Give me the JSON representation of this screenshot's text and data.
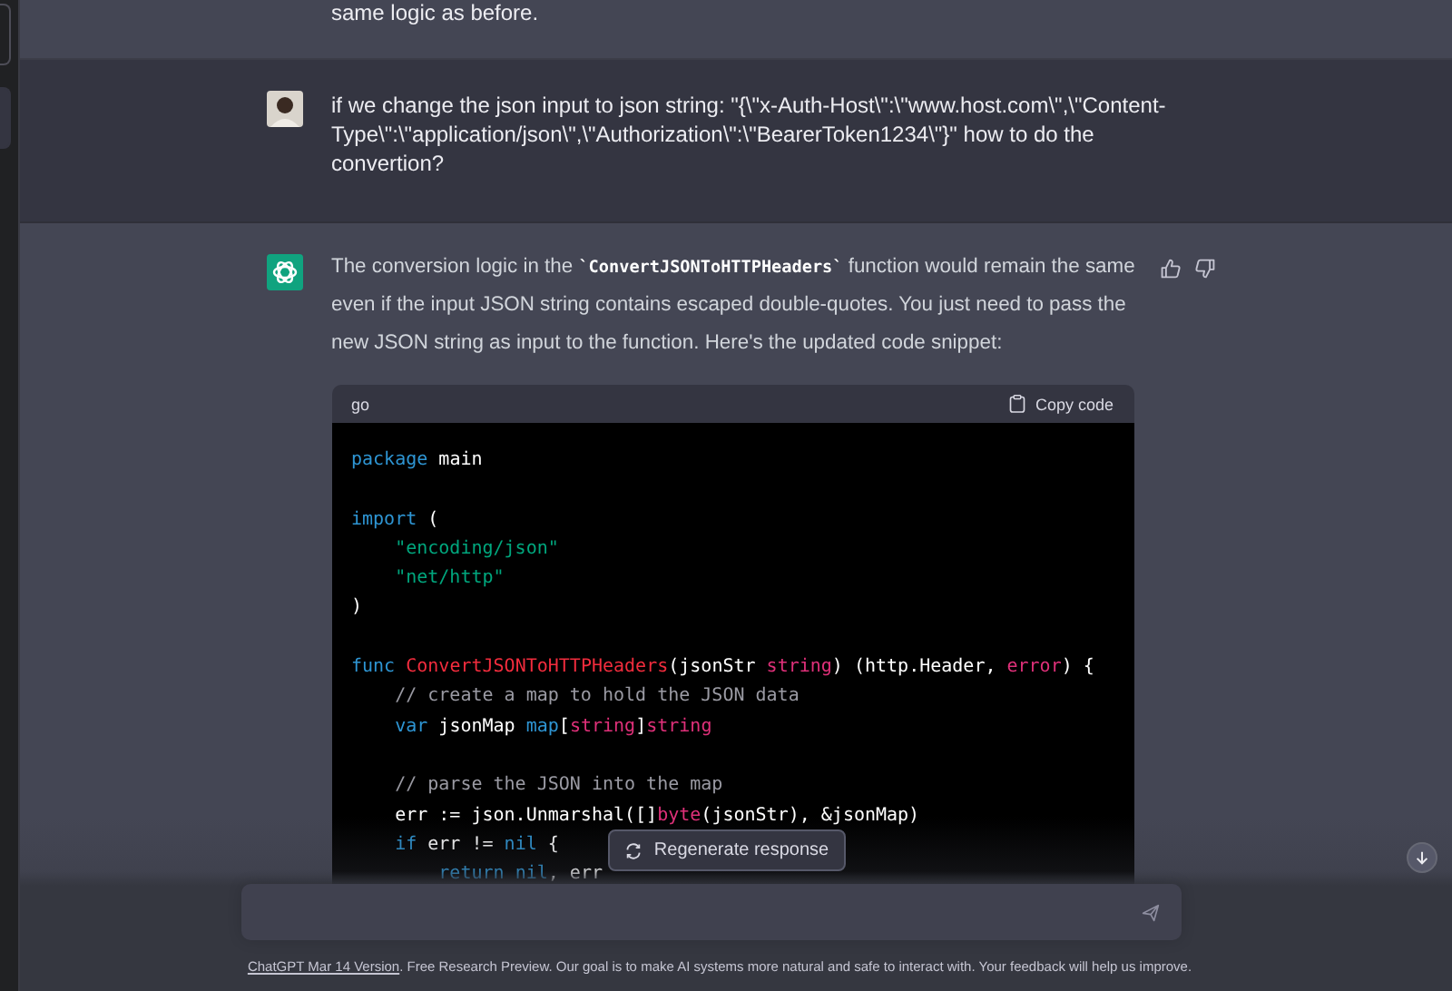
{
  "sidebar": {
    "items": [
      {
        "selected": false
      },
      {
        "selected": true
      }
    ]
  },
  "previous_message": {
    "text": "same logic as before."
  },
  "user_message": {
    "text": "if we change the json input to json string: \"{\\\"x-Auth-Host\\\":\\\"www.host.com\\\",\\\"Content-Type\\\":\\\"application/json\\\",\\\"Authorization\\\":\\\"BearerToken1234\\\"}\" how to do the convertion?"
  },
  "assistant_message": {
    "parts": [
      {
        "kind": "text",
        "text": "The conversion logic in the "
      },
      {
        "kind": "code",
        "text": "`ConvertJSONToHTTPHeaders`"
      },
      {
        "kind": "text",
        "text": " function would remain the same even if the input JSON string contains escaped double-quotes. You just need to pass the new JSON string as input to the function. Here's the updated code snippet:"
      }
    ],
    "code_block": {
      "language": "go",
      "copy_label": "Copy code",
      "sections": [
        {
          "lines": [
            [
              {
                "kind": "keyword",
                "text": "package"
              },
              {
                "kind": "plain",
                "text": " main"
              }
            ]
          ]
        },
        {
          "lines": [
            [
              {
                "kind": "keyword",
                "text": "import"
              },
              {
                "kind": "plain",
                "text": " ("
              }
            ],
            [
              {
                "kind": "string",
                "text": "    \"encoding/json\""
              }
            ],
            [
              {
                "kind": "string",
                "text": "    \"net/http\""
              }
            ],
            [
              {
                "kind": "plain",
                "text": ")"
              }
            ]
          ]
        },
        {
          "lines": [
            [
              {
                "kind": "keyword",
                "text": "func"
              },
              {
                "kind": "func",
                "text": " ConvertJSONToHTTPHeaders"
              },
              {
                "kind": "plain",
                "text": "(jsonStr "
              },
              {
                "kind": "type",
                "text": "string"
              },
              {
                "kind": "plain",
                "text": ") (http.Header, "
              },
              {
                "kind": "type",
                "text": "error"
              },
              {
                "kind": "plain",
                "text": ") {"
              }
            ],
            [
              {
                "kind": "comment",
                "text": "    // create a map to hold the JSON data"
              }
            ],
            [
              {
                "kind": "keyword",
                "text": "    var"
              },
              {
                "kind": "plain",
                "text": " jsonMap "
              },
              {
                "kind": "keyword",
                "text": "map"
              },
              {
                "kind": "plain",
                "text": "["
              },
              {
                "kind": "type",
                "text": "string"
              },
              {
                "kind": "plain",
                "text": "]"
              },
              {
                "kind": "type",
                "text": "string"
              }
            ]
          ]
        },
        {
          "lines": [
            [
              {
                "kind": "comment",
                "text": "    // parse the JSON into the map"
              }
            ],
            [
              {
                "kind": "plain",
                "text": "    err := json.Unmarshal([]"
              },
              {
                "kind": "type",
                "text": "byte"
              },
              {
                "kind": "plain",
                "text": "(jsonStr), &jsonMap)"
              }
            ],
            [
              {
                "kind": "keyword",
                "text": "    if"
              },
              {
                "kind": "plain",
                "text": " err != "
              },
              {
                "kind": "keyword",
                "text": "nil"
              },
              {
                "kind": "plain",
                "text": " {"
              }
            ],
            [
              {
                "kind": "keyword",
                "text": "        return"
              },
              {
                "kind": "keyword",
                "text": " nil"
              },
              {
                "kind": "plain",
                "text": ", err"
              }
            ]
          ]
        }
      ]
    }
  },
  "regenerate_button": {
    "label": "Regenerate response"
  },
  "footer": {
    "link": "ChatGPT Mar 14 Version",
    "text": ". Free Research Preview. Our goal is to make AI systems more natural and safe to interact with. Your feedback will help us improve."
  }
}
